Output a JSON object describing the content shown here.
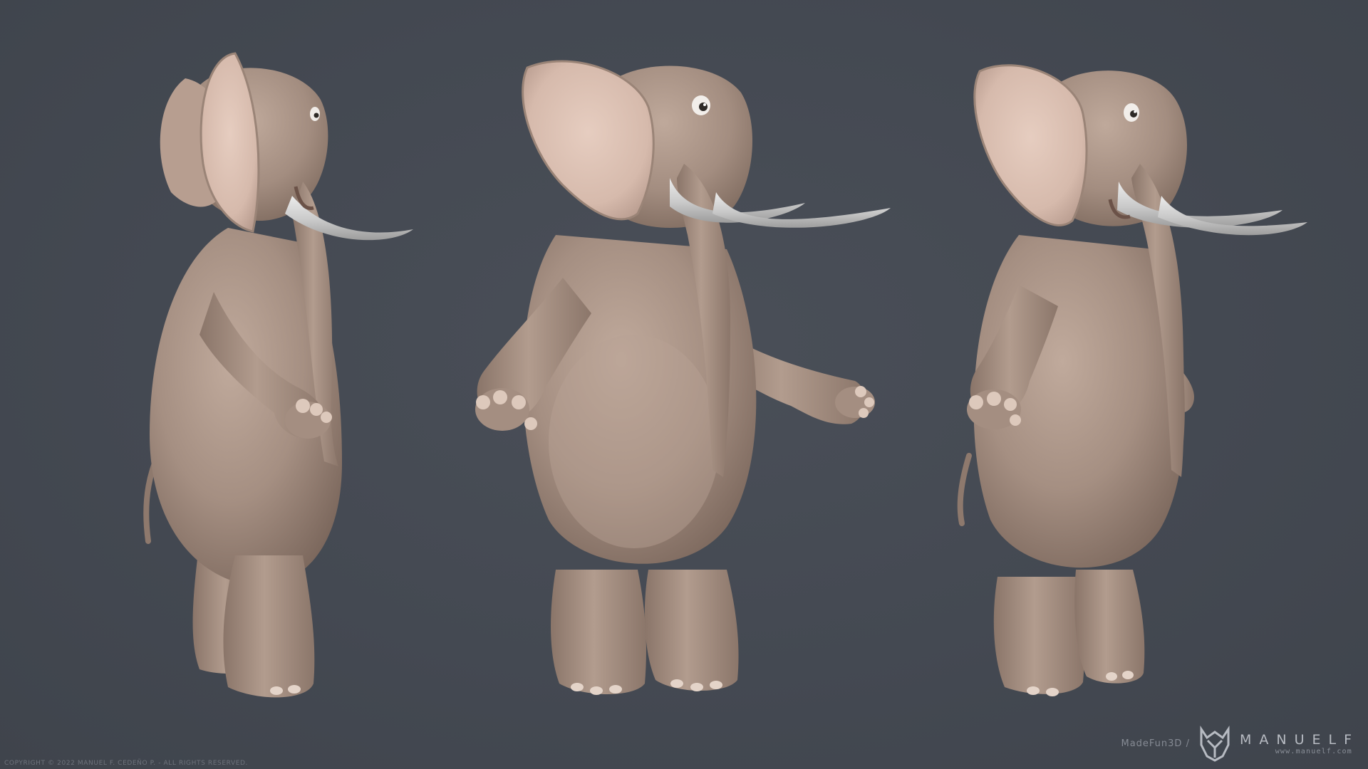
{
  "scene": {
    "background_color": "#454a53",
    "skin_color": "#a58f82",
    "ear_inner_color": "#dcc1b4",
    "tusk_color": "#cfcfcf",
    "toenail_color": "#e4d4c9",
    "views": [
      {
        "name": "side view",
        "icon": "elephant-side-view"
      },
      {
        "name": "front three-quarter view",
        "icon": "elephant-front-three-quarter"
      },
      {
        "name": "three-quarter view",
        "icon": "elephant-three-quarter"
      }
    ]
  },
  "footer": {
    "copyright": "COPYRIGHT © 2022 MANUEL F. CEDEÑO P. - ALL RIGHTS RESERVED.",
    "brand_prefix": "MadeFun3D /",
    "brand_name": "MANUELF",
    "brand_url": "www.manuelf.com"
  }
}
